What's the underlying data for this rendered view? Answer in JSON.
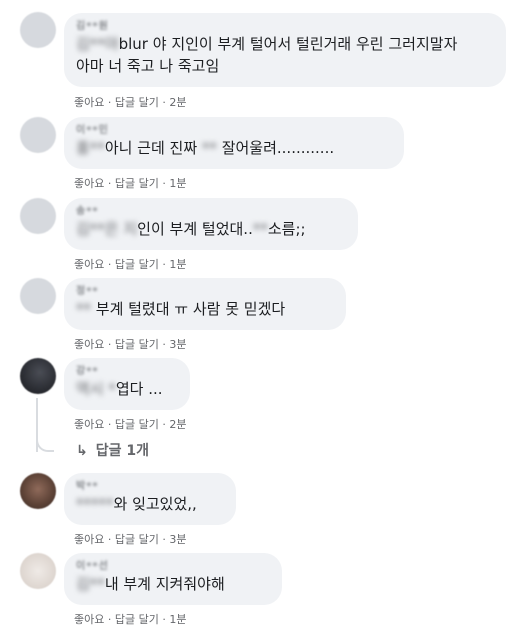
{
  "comments": [
    {
      "name": "김**원",
      "text": [
        [
          "김**야",
          "blur"
        ],
        [
          " 야 지인이 부계 털어서 털린거래 우린 그러지말자\n아마 너 죽고 나 죽고임",
          ""
        ]
      ],
      "time": "2분"
    },
    {
      "name": "이**민",
      "text": [
        [
          "홍**",
          "blur"
        ],
        [
          "아니 근데 진짜 ",
          ""
        ],
        [
          "**",
          "blur"
        ],
        [
          " 잘어울려............",
          ""
        ]
      ],
      "time": "1분"
    },
    {
      "name": "송**",
      "text": [
        [
          "김**은 지",
          "blur"
        ],
        [
          "인이 부계 털었대..",
          ""
        ],
        [
          "**",
          "blur"
        ],
        [
          "소름;;",
          ""
        ]
      ],
      "time": "1분"
    },
    {
      "name": "정**",
      "text": [
        [
          "**",
          "blur"
        ],
        [
          " 부계 털렸대 ㅠ 사람 못 믿겠다",
          ""
        ]
      ],
      "time": "3분"
    },
    {
      "name": "강**",
      "text": [
        [
          "역시 ",
          "blur"
        ],
        [
          "*",
          "blur"
        ],
        [
          "엽다 ...",
          ""
        ]
      ],
      "time": "2분"
    },
    {
      "name": "박**",
      "text": [
        [
          "*****",
          "blur"
        ],
        [
          "와 잊고있었,,",
          ""
        ]
      ],
      "time": "3분"
    },
    {
      "name": "이**선",
      "text": [
        [
          "김**",
          "blur"
        ],
        [
          "내 부계 지켜줘야해",
          ""
        ]
      ],
      "time": "1분"
    }
  ],
  "actions": {
    "like": "좋아요",
    "reply": "답글 달기",
    "sep": "·"
  },
  "reply_count_link": "답글 1개",
  "reply_arrow": "↳"
}
